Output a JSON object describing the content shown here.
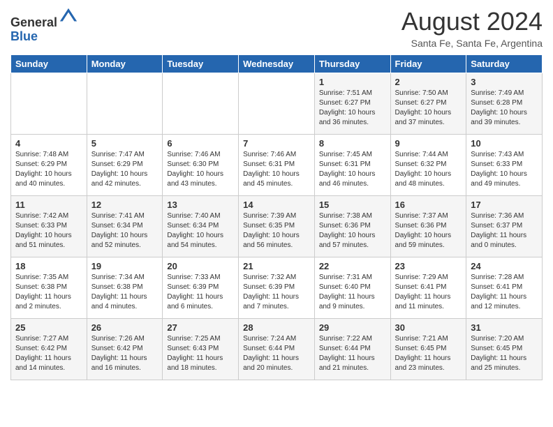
{
  "header": {
    "logo_general": "General",
    "logo_blue": "Blue",
    "month_title": "August 2024",
    "location": "Santa Fe, Santa Fe, Argentina"
  },
  "days_of_week": [
    "Sunday",
    "Monday",
    "Tuesday",
    "Wednesday",
    "Thursday",
    "Friday",
    "Saturday"
  ],
  "weeks": [
    [
      {
        "day": "",
        "info": ""
      },
      {
        "day": "",
        "info": ""
      },
      {
        "day": "",
        "info": ""
      },
      {
        "day": "",
        "info": ""
      },
      {
        "day": "1",
        "info": "Sunrise: 7:51 AM\nSunset: 6:27 PM\nDaylight: 10 hours\nand 36 minutes."
      },
      {
        "day": "2",
        "info": "Sunrise: 7:50 AM\nSunset: 6:27 PM\nDaylight: 10 hours\nand 37 minutes."
      },
      {
        "day": "3",
        "info": "Sunrise: 7:49 AM\nSunset: 6:28 PM\nDaylight: 10 hours\nand 39 minutes."
      }
    ],
    [
      {
        "day": "4",
        "info": "Sunrise: 7:48 AM\nSunset: 6:29 PM\nDaylight: 10 hours\nand 40 minutes."
      },
      {
        "day": "5",
        "info": "Sunrise: 7:47 AM\nSunset: 6:29 PM\nDaylight: 10 hours\nand 42 minutes."
      },
      {
        "day": "6",
        "info": "Sunrise: 7:46 AM\nSunset: 6:30 PM\nDaylight: 10 hours\nand 43 minutes."
      },
      {
        "day": "7",
        "info": "Sunrise: 7:46 AM\nSunset: 6:31 PM\nDaylight: 10 hours\nand 45 minutes."
      },
      {
        "day": "8",
        "info": "Sunrise: 7:45 AM\nSunset: 6:31 PM\nDaylight: 10 hours\nand 46 minutes."
      },
      {
        "day": "9",
        "info": "Sunrise: 7:44 AM\nSunset: 6:32 PM\nDaylight: 10 hours\nand 48 minutes."
      },
      {
        "day": "10",
        "info": "Sunrise: 7:43 AM\nSunset: 6:33 PM\nDaylight: 10 hours\nand 49 minutes."
      }
    ],
    [
      {
        "day": "11",
        "info": "Sunrise: 7:42 AM\nSunset: 6:33 PM\nDaylight: 10 hours\nand 51 minutes."
      },
      {
        "day": "12",
        "info": "Sunrise: 7:41 AM\nSunset: 6:34 PM\nDaylight: 10 hours\nand 52 minutes."
      },
      {
        "day": "13",
        "info": "Sunrise: 7:40 AM\nSunset: 6:34 PM\nDaylight: 10 hours\nand 54 minutes."
      },
      {
        "day": "14",
        "info": "Sunrise: 7:39 AM\nSunset: 6:35 PM\nDaylight: 10 hours\nand 56 minutes."
      },
      {
        "day": "15",
        "info": "Sunrise: 7:38 AM\nSunset: 6:36 PM\nDaylight: 10 hours\nand 57 minutes."
      },
      {
        "day": "16",
        "info": "Sunrise: 7:37 AM\nSunset: 6:36 PM\nDaylight: 10 hours\nand 59 minutes."
      },
      {
        "day": "17",
        "info": "Sunrise: 7:36 AM\nSunset: 6:37 PM\nDaylight: 11 hours\nand 0 minutes."
      }
    ],
    [
      {
        "day": "18",
        "info": "Sunrise: 7:35 AM\nSunset: 6:38 PM\nDaylight: 11 hours\nand 2 minutes."
      },
      {
        "day": "19",
        "info": "Sunrise: 7:34 AM\nSunset: 6:38 PM\nDaylight: 11 hours\nand 4 minutes."
      },
      {
        "day": "20",
        "info": "Sunrise: 7:33 AM\nSunset: 6:39 PM\nDaylight: 11 hours\nand 6 minutes."
      },
      {
        "day": "21",
        "info": "Sunrise: 7:32 AM\nSunset: 6:39 PM\nDaylight: 11 hours\nand 7 minutes."
      },
      {
        "day": "22",
        "info": "Sunrise: 7:31 AM\nSunset: 6:40 PM\nDaylight: 11 hours\nand 9 minutes."
      },
      {
        "day": "23",
        "info": "Sunrise: 7:29 AM\nSunset: 6:41 PM\nDaylight: 11 hours\nand 11 minutes."
      },
      {
        "day": "24",
        "info": "Sunrise: 7:28 AM\nSunset: 6:41 PM\nDaylight: 11 hours\nand 12 minutes."
      }
    ],
    [
      {
        "day": "25",
        "info": "Sunrise: 7:27 AM\nSunset: 6:42 PM\nDaylight: 11 hours\nand 14 minutes."
      },
      {
        "day": "26",
        "info": "Sunrise: 7:26 AM\nSunset: 6:42 PM\nDaylight: 11 hours\nand 16 minutes."
      },
      {
        "day": "27",
        "info": "Sunrise: 7:25 AM\nSunset: 6:43 PM\nDaylight: 11 hours\nand 18 minutes."
      },
      {
        "day": "28",
        "info": "Sunrise: 7:24 AM\nSunset: 6:44 PM\nDaylight: 11 hours\nand 20 minutes."
      },
      {
        "day": "29",
        "info": "Sunrise: 7:22 AM\nSunset: 6:44 PM\nDaylight: 11 hours\nand 21 minutes."
      },
      {
        "day": "30",
        "info": "Sunrise: 7:21 AM\nSunset: 6:45 PM\nDaylight: 11 hours\nand 23 minutes."
      },
      {
        "day": "31",
        "info": "Sunrise: 7:20 AM\nSunset: 6:45 PM\nDaylight: 11 hours\nand 25 minutes."
      }
    ]
  ]
}
